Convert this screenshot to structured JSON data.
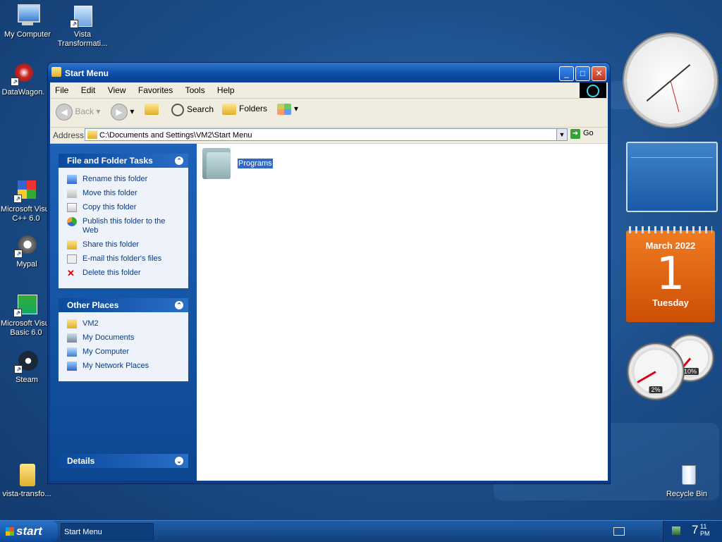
{
  "desktop": {
    "icons": [
      {
        "label": "My Computer"
      },
      {
        "label": "Vista Transformati..."
      },
      {
        "label": "DataWagon."
      },
      {
        "label": "Microsoft Visu. C++ 6.0"
      },
      {
        "label": "Mypal"
      },
      {
        "label": "Microsoft Visu. Basic 6.0"
      },
      {
        "label": "Steam"
      },
      {
        "label": "vista-transfo..."
      },
      {
        "label": "Recycle Bin"
      }
    ]
  },
  "window": {
    "title": "Start Menu",
    "menu": [
      "File",
      "Edit",
      "View",
      "Favorites",
      "Tools",
      "Help"
    ],
    "toolbar": {
      "back": "Back",
      "search": "Search",
      "folders": "Folders"
    },
    "address": {
      "label": "Address",
      "value": "C:\\Documents and Settings\\VM2\\Start Menu",
      "go": "Go"
    },
    "tasks_panel": {
      "title": "File and Folder Tasks",
      "items": [
        "Rename this folder",
        "Move this folder",
        "Copy this folder",
        "Publish this folder to the Web",
        "Share this folder",
        "E-mail this folder's files",
        "Delete this folder"
      ]
    },
    "places_panel": {
      "title": "Other Places",
      "items": [
        "VM2",
        "My Documents",
        "My Computer",
        "My Network Places"
      ]
    },
    "details_panel": {
      "title": "Details"
    },
    "content": {
      "folder_name": "Programs"
    }
  },
  "gadgets": {
    "calendar": {
      "month": "March 2022",
      "day": "1",
      "weekday": "Tuesday"
    },
    "meters": {
      "cpu": "2%",
      "memory": "10%"
    }
  },
  "taskbar": {
    "start": "start",
    "task": "Start Menu",
    "clock_hour": "7",
    "clock_min": "11",
    "clock_ampm": "PM"
  }
}
